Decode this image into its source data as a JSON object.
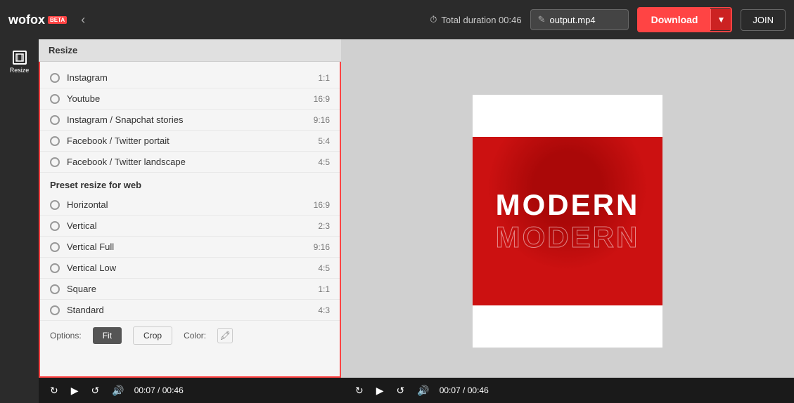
{
  "topbar": {
    "logo_text": "wofox",
    "logo_badge": "BETA",
    "duration_label": "Total duration 00:46",
    "filename": "output.mp4",
    "download_label": "Download",
    "join_label": "JOIN"
  },
  "sidebar": {
    "resize_label": "Resize"
  },
  "resize_panel": {
    "title": "Resize",
    "options": [
      {
        "label": "Instagram",
        "ratio": "1:1"
      },
      {
        "label": "Youtube",
        "ratio": "16:9"
      },
      {
        "label": "Instagram / Snapchat stories",
        "ratio": "9:16"
      },
      {
        "label": "Facebook / Twitter portait",
        "ratio": "5:4"
      },
      {
        "label": "Facebook / Twitter landscape",
        "ratio": "4:5"
      }
    ],
    "web_section_title": "Preset resize for web",
    "web_options": [
      {
        "label": "Horizontal",
        "ratio": "16:9"
      },
      {
        "label": "Vertical",
        "ratio": "2:3"
      },
      {
        "label": "Vertical Full",
        "ratio": "9:16"
      },
      {
        "label": "Vertical Low",
        "ratio": "4:5"
      },
      {
        "label": "Square",
        "ratio": "1:1"
      },
      {
        "label": "Standard",
        "ratio": "4:3"
      }
    ],
    "options_label": "Options:",
    "fit_label": "Fit",
    "crop_label": "Crop",
    "color_label": "Color:",
    "timecode": "00:07 / 00:46"
  },
  "preview": {
    "timecode": "00:07 / 00:46",
    "video_text_line1": "MODERN",
    "video_text_line2": "MODERN"
  }
}
